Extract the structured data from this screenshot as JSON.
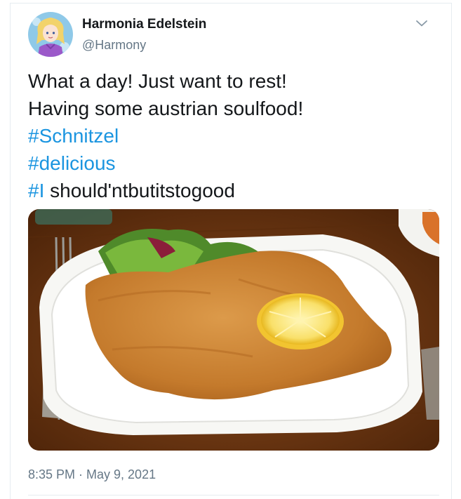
{
  "user": {
    "display_name": "Harmonia Edelstein",
    "handle": "@Harmony",
    "avatar_icon": "anime-avatar"
  },
  "tweet": {
    "line1": "What a day! Just want to rest!",
    "line2": "Having some austrian soulfood!",
    "hashtag1": "#Schnitzel",
    "hashtag2": "#delicious",
    "hashtag3": "#I",
    "line5_rest": " should'ntbutitstogood",
    "timestamp": "8:35 PM · May 9, 2021",
    "media_icon": "schnitzel-photo"
  },
  "menu": {
    "icon": "chevron-down-icon"
  },
  "colors": {
    "link": "#1b95e0",
    "text": "#14171a",
    "secondary": "#657786",
    "border": "#e6ecf0"
  }
}
